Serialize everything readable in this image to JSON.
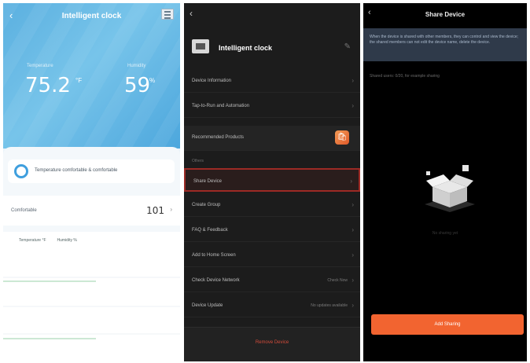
{
  "panel1": {
    "title": "Intelligent clock",
    "back_glyph": "‹",
    "temperature": {
      "label": "Temperature",
      "value": "75.2",
      "unit": "°F"
    },
    "humidity": {
      "label": "Humidity",
      "value": "59",
      "unit": "%"
    },
    "status_text": "Temperature comfortable & comfortable",
    "comfort_row": {
      "label": "Comfortable",
      "value": "101",
      "chevron": "›"
    },
    "legend": [
      "Temperature °F",
      "Humidity %"
    ],
    "icon_names": {
      "status": "comfort-ring-icon",
      "menu": "menu-icon"
    }
  },
  "panel2": {
    "back_glyph": "‹",
    "device_name": "Intelligent clock",
    "edit_glyph": "✎",
    "items_top": [
      {
        "label": "Device Information"
      },
      {
        "label": "Tap-to-Run and Automation"
      }
    ],
    "recommended": {
      "label": "Recommended Products",
      "icon": "🛍"
    },
    "section_label": "Others",
    "items_others": [
      {
        "label": "Share Device",
        "selected": true
      },
      {
        "label": "Create Group"
      },
      {
        "label": "FAQ & Feedback"
      },
      {
        "label": "Add to Home Screen"
      },
      {
        "label": "Check Device Network",
        "right": "Check Now"
      },
      {
        "label": "Device Update",
        "right": "No updates available"
      }
    ],
    "remove_label": "Remove Device",
    "chevron": "›"
  },
  "panel3": {
    "back_glyph": "‹",
    "title": "Share Device",
    "banner": "When the device is shared with other members, they can control and view the device; the shared members can not edit the device name, delete the device.",
    "hint": "Shared users: 0/20, for example sharing",
    "empty_text": "No sharing yet",
    "add_button": "Add Sharing",
    "colors": {
      "accent": "#f26430",
      "banner": "#2f3a4a"
    }
  }
}
